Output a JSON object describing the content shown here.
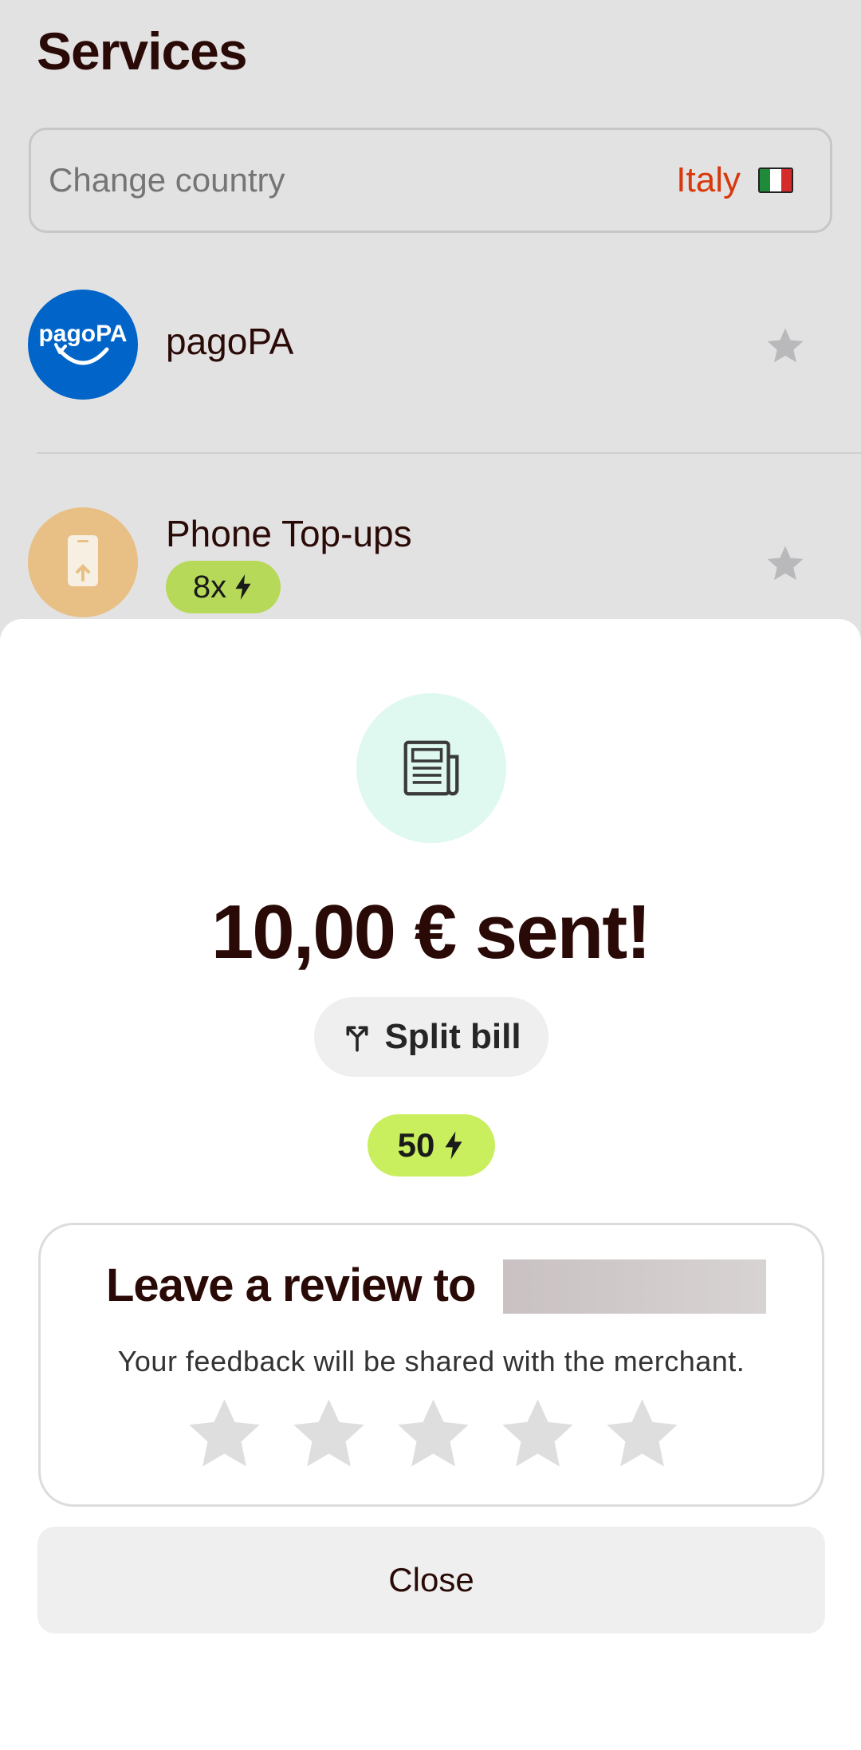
{
  "header": {
    "title": "Services"
  },
  "country": {
    "label": "Change country",
    "value": "Italy",
    "flag_colors": [
      "#1f8a3a",
      "#ffffff",
      "#d62b2b"
    ]
  },
  "services": [
    {
      "name": "pagoPA",
      "logo_text": "pagoPA",
      "logo_color": "#0064c8"
    },
    {
      "name": "Phone Top-ups",
      "badge": "8x",
      "logo_color": "#e8c086"
    }
  ],
  "sheet": {
    "icon": "receipt-icon",
    "amount_text": "10,00 € sent!",
    "split_label": "Split bill",
    "points": "50",
    "review": {
      "title": "Leave a review to",
      "subtitle": "Your feedback will be shared with the merchant.",
      "stars": 5
    },
    "close_label": "Close"
  },
  "colors": {
    "accent_text": "#2a0a06",
    "country_value": "#d8380c",
    "points_badge": "#c9ef5f",
    "receipt_circle": "#dff9f0"
  }
}
